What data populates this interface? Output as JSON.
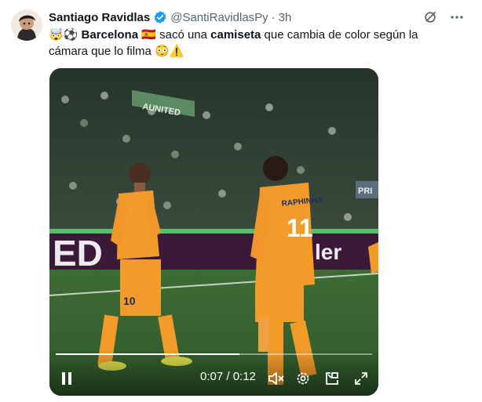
{
  "author": {
    "display_name": "Santiago Ravidlas",
    "handle": "@SantiRavidlasPy",
    "separator": "·",
    "time": "3h",
    "verified": true
  },
  "post": {
    "emoji_prefix": "🤯⚽",
    "team": "Barcelona",
    "flag": "🇪🇸",
    "text_1": " sacó una ",
    "keyword": "camiseta",
    "text_2": " que cambia de color según la cámara que lo filma ",
    "emoji_suffix": "😳⚠️"
  },
  "video": {
    "time_display": "0:07 / 0:12",
    "progress": 0.58,
    "banner_text": "ED",
    "banner_text_right": "ler",
    "player_left_number": "10",
    "player_right_number": "11",
    "player_right_name": "RAPHINHA",
    "stand_sign": "AUNITED",
    "corner_sign": "PRI"
  },
  "icons": {
    "grok": "grok-icon",
    "more": "more-icon",
    "pause": "pause-icon",
    "mute": "mute-icon",
    "settings": "settings-icon",
    "pip": "picture-in-picture-icon",
    "fullscreen": "fullscreen-icon"
  },
  "colors": {
    "verified_blue": "#1d9bf0",
    "kit_orange": "#f39b2a",
    "pitch_green": "#3d6b35",
    "text_secondary": "#536471"
  }
}
